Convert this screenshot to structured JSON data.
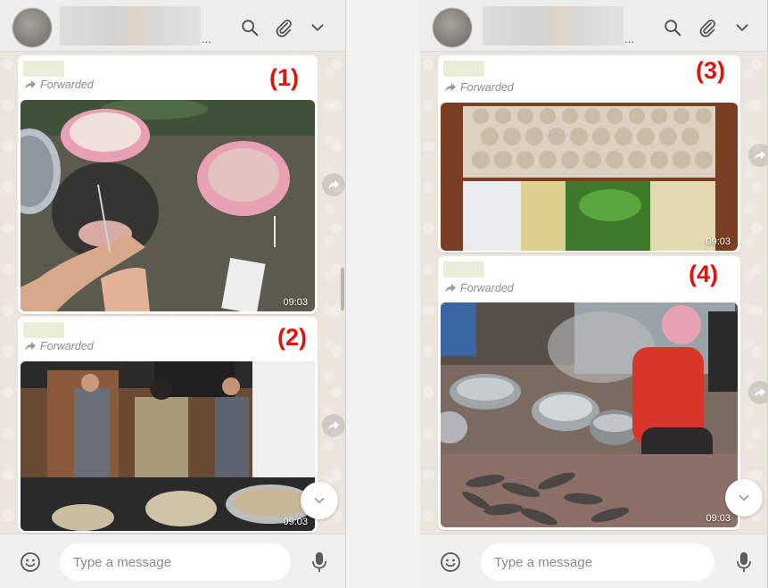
{
  "left_panel": {
    "contact_ellipsis": "...",
    "messages": [
      {
        "forwarded_label": "Forwarded",
        "number_label": "(1)",
        "time": "09:03"
      },
      {
        "forwarded_label": "Forwarded",
        "number_label": "(2)",
        "time": "09:03"
      }
    ],
    "composer": {
      "placeholder": "Type a message"
    }
  },
  "right_panel": {
    "contact_ellipsis": "...",
    "messages": [
      {
        "forwarded_label": "Forwarded",
        "number_label": "(3)",
        "time": "09:03"
      },
      {
        "forwarded_label": "Forwarded",
        "number_label": "(4)",
        "time": "09:03"
      }
    ],
    "composer": {
      "placeholder": "Type a message"
    }
  },
  "colors": {
    "label_red": "#e0130e",
    "chat_background": "#ece5dd",
    "header_background": "#ededed"
  },
  "icons": [
    "search-icon",
    "attach-icon",
    "chevron-down-icon",
    "emoji-icon",
    "mic-icon",
    "forward-icon"
  ]
}
